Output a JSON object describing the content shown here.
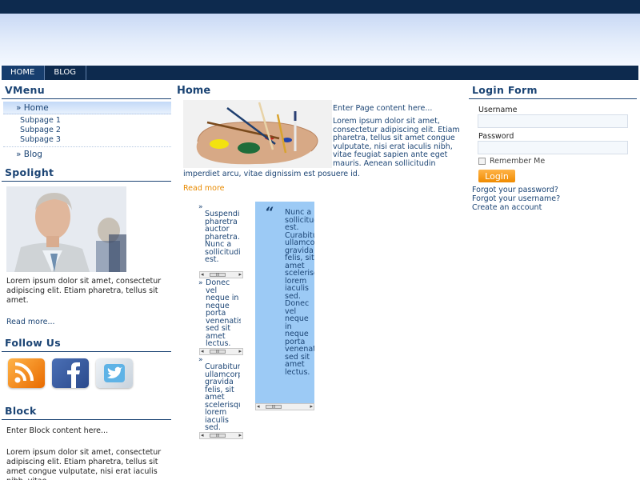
{
  "nav": {
    "items": [
      "HOME",
      "BLOG"
    ]
  },
  "vmenu": {
    "title": "VMenu",
    "home": "» Home",
    "subpages": [
      "Subpage 1",
      "Subpage 2",
      "Subpage 3"
    ],
    "blog": "» Blog"
  },
  "spotlight": {
    "title": "Spolight",
    "text": "Lorem ipsum dolor sit amet, consectetur adipiscing elit. Etiam pharetra, tellus sit amet.",
    "read_more": "Read more..."
  },
  "follow": {
    "title": "Follow Us",
    "icons": [
      "rss-icon",
      "facebook-icon",
      "twitter-icon"
    ]
  },
  "block": {
    "title": "Block",
    "intro": "Enter Block content here...",
    "text": "Lorem ipsum dolor sit amet, consectetur adipiscing elit. Etiam pharetra, tellus sit amet congue vulputate, nisi erat iaculis nibh, vitae"
  },
  "main": {
    "title": "Home",
    "intro": "Enter Page content here...",
    "para": "Lorem ipsum dolor sit amet, consectetur adipiscing elit. Etiam pharetra, tellus sit amet congue vulputate, nisi erat iaculis nibh, vitae feugiat sapien ante eget mauris. Aenean sollicitudin",
    "para_end": "imperdiet arcu, vitae dignissim est posuere id.",
    "read_more": "Read more",
    "bullets": [
      "Suspendisse pharetra auctor pharetra. Nunc a sollicitudin est.",
      "Donec vel neque in neque porta venenatis sed sit amet lectus.",
      "Curabitur ullamcorper gravida felis, sit amet scelerisque lorem iaculis sed."
    ],
    "quote": "Nunc a sollicitudin est. Curabitur ullamcorper gravida felis, sit amet scelerisque lorem iaculis sed. Donec vel neque in neque porta venenatis sed sit amet lectus.",
    "scroll_thumb": "III"
  },
  "login": {
    "title": "Login Form",
    "username_label": "Username",
    "password_label": "Password",
    "remember": "Remember Me",
    "button": "Login",
    "links": [
      "Forgot your password?",
      "Forgot your username?",
      "Create an account"
    ]
  },
  "colors": {
    "navy": "#0d2a4e",
    "title_blue": "#1b4474",
    "accent_orange": "#e88a00",
    "quote_bg": "#9ccaf5"
  }
}
